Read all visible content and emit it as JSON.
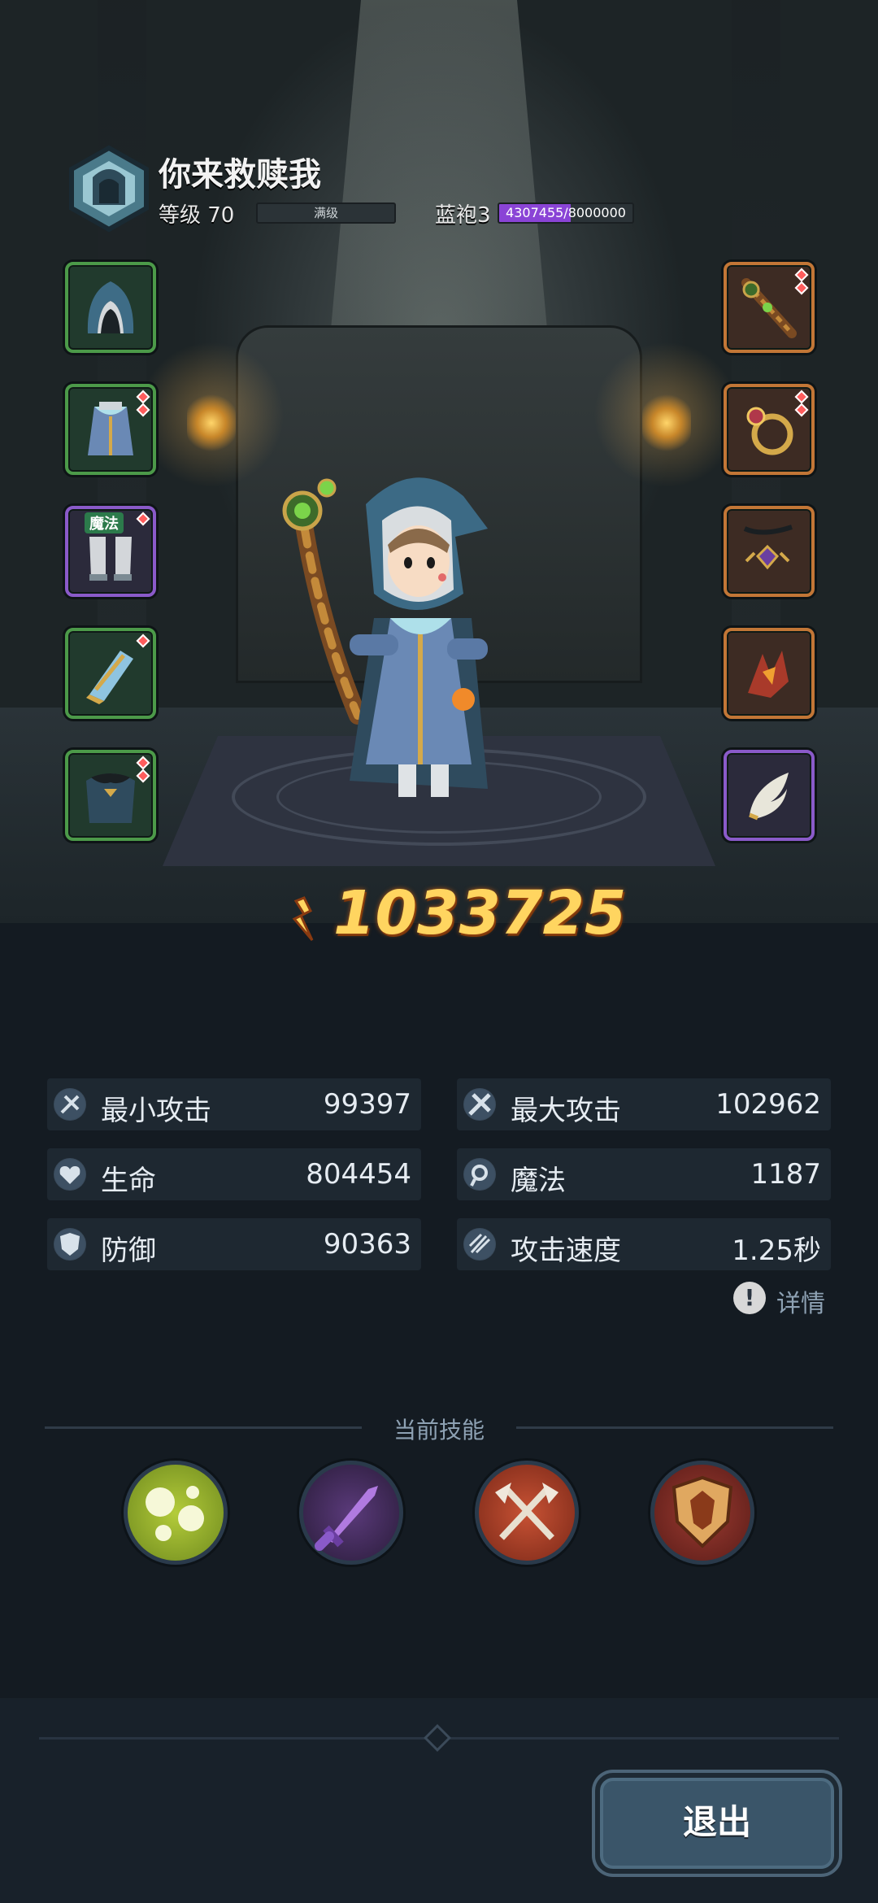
{
  "player": {
    "name": "你来救赎我",
    "level_label": "等级 70",
    "level_status": "满级",
    "class_label": "蓝袍3",
    "exp_current": 4307455,
    "exp_max": 8000000,
    "exp_text": "4307455/8000000"
  },
  "equipment": {
    "left": [
      {
        "name": "hood",
        "rarity": "green"
      },
      {
        "name": "robe",
        "rarity": "green"
      },
      {
        "name": "boots",
        "rarity": "purple",
        "tag": "魔法"
      },
      {
        "name": "bracer",
        "rarity": "green"
      },
      {
        "name": "cloak",
        "rarity": "green"
      }
    ],
    "right": [
      {
        "name": "staff",
        "rarity": "orange"
      },
      {
        "name": "ring",
        "rarity": "orange"
      },
      {
        "name": "necklace",
        "rarity": "orange"
      },
      {
        "name": "claw-amulet",
        "rarity": "orange"
      },
      {
        "name": "wing-charm",
        "rarity": "purple"
      }
    ]
  },
  "power": {
    "value": "1033725"
  },
  "stats": [
    {
      "icon": "min-attack-icon",
      "label": "最小攻击",
      "value": "99397"
    },
    {
      "icon": "max-attack-icon",
      "label": "最大攻击",
      "value": "102962"
    },
    {
      "icon": "life-icon",
      "label": "生命",
      "value": "804454"
    },
    {
      "icon": "magic-icon",
      "label": "魔法",
      "value": "1187"
    },
    {
      "icon": "defense-icon",
      "label": "防御",
      "value": "90363"
    },
    {
      "icon": "attack-speed-icon",
      "label": "攻击速度",
      "value": "1.25秒"
    }
  ],
  "detail": {
    "label": "详情",
    "icon_glyph": "!"
  },
  "skills": {
    "title": "当前技能",
    "items": [
      {
        "name": "poison-bubbles-skill-icon",
        "color": "#9bb52a"
      },
      {
        "name": "shadow-blade-skill-icon",
        "color": "#6b3ea0"
      },
      {
        "name": "crossed-axes-skill-icon",
        "color": "#b5442c"
      },
      {
        "name": "guard-shield-skill-icon",
        "color": "#7e2f2a"
      }
    ]
  },
  "footer": {
    "exit_label": "退出"
  },
  "colors": {
    "accent_gold": "#ffd560",
    "exp_purple": "#8a44d6",
    "panel_bg": "#141b22"
  }
}
